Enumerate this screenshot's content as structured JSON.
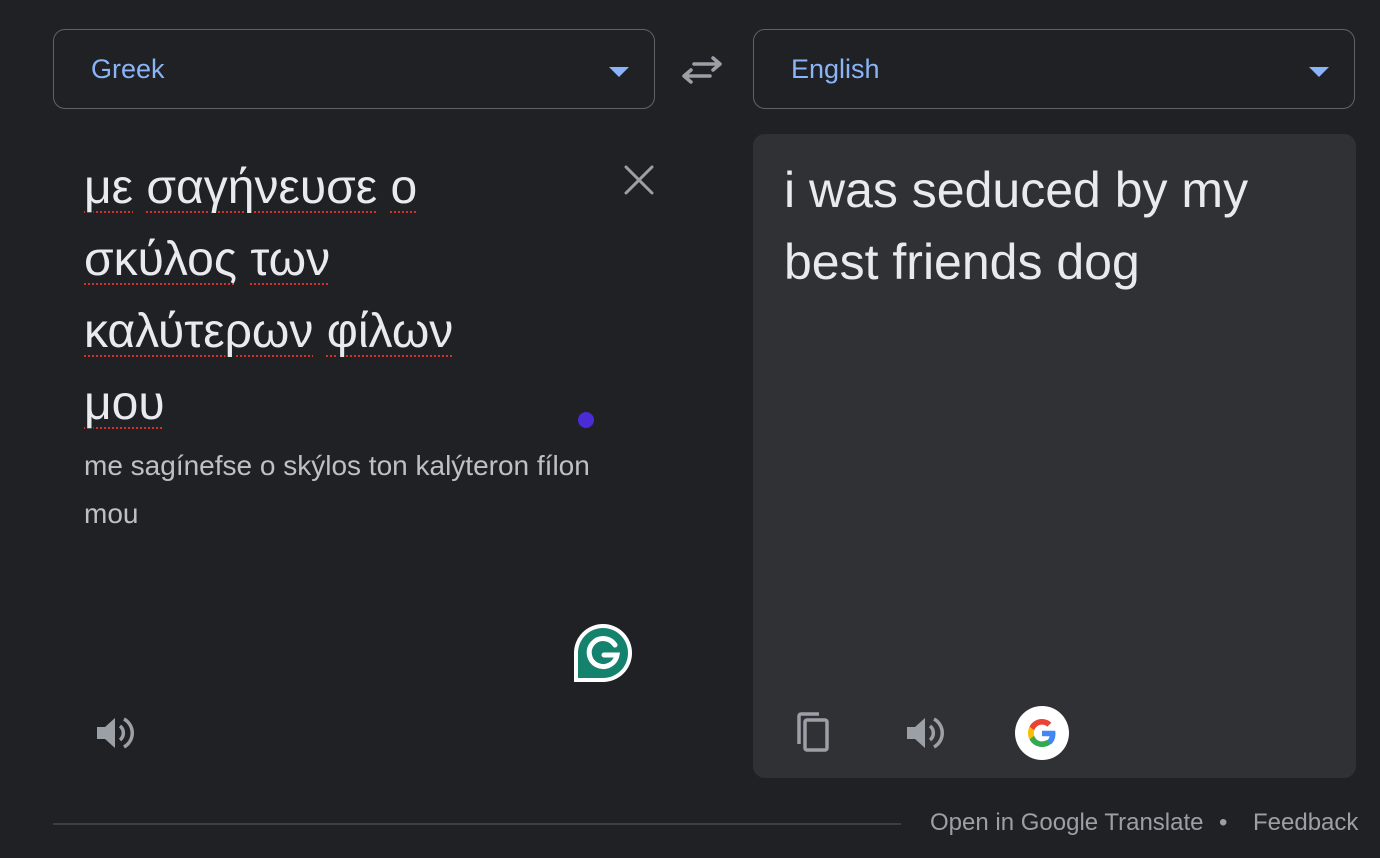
{
  "source_language": {
    "label": "Greek",
    "icon": "chevron-down-icon"
  },
  "target_language": {
    "label": "English",
    "icon": "chevron-down-icon"
  },
  "swap_icon": "swap-arrows-icon",
  "source": {
    "words_line1": [
      "με",
      "σαγήνευσε",
      "ο"
    ],
    "words_line2": [
      "σκύλος",
      "των"
    ],
    "words_line3": [
      "καλύτερων",
      "φίλων"
    ],
    "words_line4": [
      "μου"
    ],
    "romanization": "me sagínefse o skýlos ton kalýteron fílon mou",
    "clear_icon": "close-icon",
    "listen_icon": "speaker-icon",
    "grammarly_icon": "grammarly-icon"
  },
  "target": {
    "text": "i was seduced by my best friends dog",
    "copy_icon": "copy-icon",
    "listen_icon": "speaker-icon",
    "google_icon": "google-logo-icon"
  },
  "footer": {
    "open_label": "Open in Google Translate",
    "separator": "•",
    "feedback_label": "Feedback"
  },
  "colors": {
    "background": "#202124",
    "panel": "#303134",
    "accent": "#8ab4f8",
    "text": "#e8eaed",
    "muted": "#9aa0a6",
    "spell_underline": "#d93025",
    "grammarly": "#15826e"
  }
}
